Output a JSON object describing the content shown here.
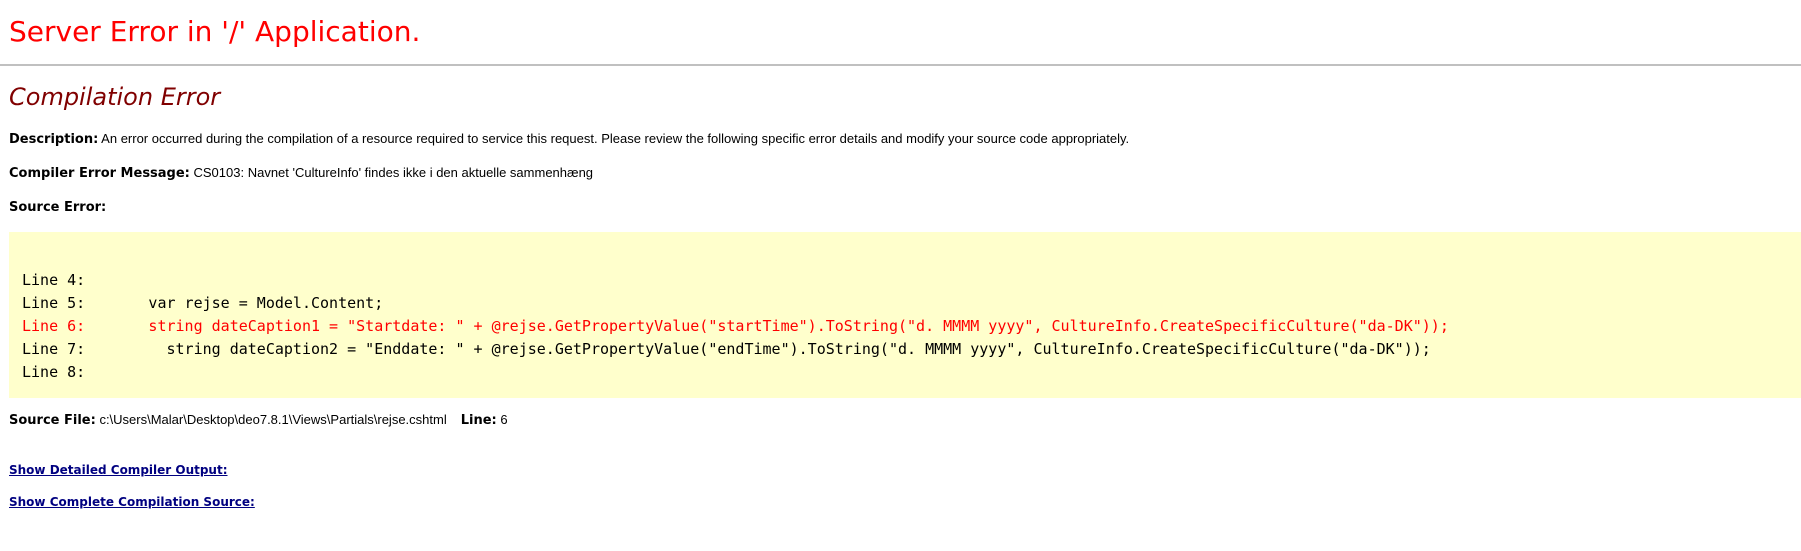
{
  "page": {
    "title": "Server Error in '/' Application.",
    "subtitle": "Compilation Error"
  },
  "description": {
    "label": "Description:",
    "text": " An error occurred during the compilation of a resource required to service this request. Please review the following specific error details and modify your source code appropriately."
  },
  "compiler_error": {
    "label": "Compiler Error Message:",
    "text": " CS0103: Navnet 'CultureInfo' findes ikke i den aktuelle sammenhæng"
  },
  "source_error": {
    "label": "Source Error:",
    "lines": [
      "Line 4:",
      "Line 5:       var rejse = Model.Content;",
      "Line 6:       string dateCaption1 = \"Startdate: \" + @rejse.GetPropertyValue(\"startTime\").ToString(\"d. MMMM yyyy\", CultureInfo.CreateSpecificCulture(\"da-DK\"));",
      "Line 7:         string dateCaption2 = \"Enddate: \" + @rejse.GetPropertyValue(\"endTime\").ToString(\"d. MMMM yyyy\", CultureInfo.CreateSpecificCulture(\"da-DK\"));",
      "Line 8:"
    ],
    "highlight_color": "#ff0000",
    "background_color": "#ffffcc"
  },
  "source_file": {
    "label": "Source File:",
    "value": " c:\\Users\\Malar\\Desktop\\deo7.8.1\\Views\\Partials\\rejse.cshtml",
    "line_label": "Line:",
    "line_value": " 6"
  },
  "links": {
    "detailed_output": "Show Detailed Compiler Output:",
    "complete_source": "Show Complete Compilation Source:"
  },
  "colors": {
    "title": "#ff0000",
    "subtitle": "#800000",
    "link": "#000080",
    "rule": "#c0c0c0"
  }
}
